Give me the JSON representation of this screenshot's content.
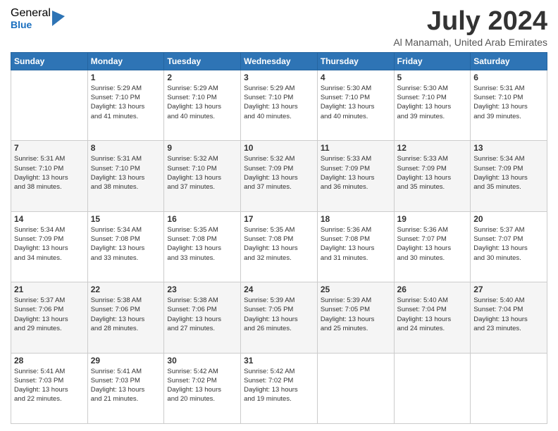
{
  "logo": {
    "general": "General",
    "blue": "Blue"
  },
  "header": {
    "month": "July 2024",
    "location": "Al Manamah, United Arab Emirates"
  },
  "weekdays": [
    "Sunday",
    "Monday",
    "Tuesday",
    "Wednesday",
    "Thursday",
    "Friday",
    "Saturday"
  ],
  "weeks": [
    [
      {
        "day": "",
        "info": ""
      },
      {
        "day": "1",
        "info": "Sunrise: 5:29 AM\nSunset: 7:10 PM\nDaylight: 13 hours\nand 41 minutes."
      },
      {
        "day": "2",
        "info": "Sunrise: 5:29 AM\nSunset: 7:10 PM\nDaylight: 13 hours\nand 40 minutes."
      },
      {
        "day": "3",
        "info": "Sunrise: 5:29 AM\nSunset: 7:10 PM\nDaylight: 13 hours\nand 40 minutes."
      },
      {
        "day": "4",
        "info": "Sunrise: 5:30 AM\nSunset: 7:10 PM\nDaylight: 13 hours\nand 40 minutes."
      },
      {
        "day": "5",
        "info": "Sunrise: 5:30 AM\nSunset: 7:10 PM\nDaylight: 13 hours\nand 39 minutes."
      },
      {
        "day": "6",
        "info": "Sunrise: 5:31 AM\nSunset: 7:10 PM\nDaylight: 13 hours\nand 39 minutes."
      }
    ],
    [
      {
        "day": "7",
        "info": "Sunrise: 5:31 AM\nSunset: 7:10 PM\nDaylight: 13 hours\nand 38 minutes."
      },
      {
        "day": "8",
        "info": "Sunrise: 5:31 AM\nSunset: 7:10 PM\nDaylight: 13 hours\nand 38 minutes."
      },
      {
        "day": "9",
        "info": "Sunrise: 5:32 AM\nSunset: 7:10 PM\nDaylight: 13 hours\nand 37 minutes."
      },
      {
        "day": "10",
        "info": "Sunrise: 5:32 AM\nSunset: 7:09 PM\nDaylight: 13 hours\nand 37 minutes."
      },
      {
        "day": "11",
        "info": "Sunrise: 5:33 AM\nSunset: 7:09 PM\nDaylight: 13 hours\nand 36 minutes."
      },
      {
        "day": "12",
        "info": "Sunrise: 5:33 AM\nSunset: 7:09 PM\nDaylight: 13 hours\nand 35 minutes."
      },
      {
        "day": "13",
        "info": "Sunrise: 5:34 AM\nSunset: 7:09 PM\nDaylight: 13 hours\nand 35 minutes."
      }
    ],
    [
      {
        "day": "14",
        "info": "Sunrise: 5:34 AM\nSunset: 7:09 PM\nDaylight: 13 hours\nand 34 minutes."
      },
      {
        "day": "15",
        "info": "Sunrise: 5:34 AM\nSunset: 7:08 PM\nDaylight: 13 hours\nand 33 minutes."
      },
      {
        "day": "16",
        "info": "Sunrise: 5:35 AM\nSunset: 7:08 PM\nDaylight: 13 hours\nand 33 minutes."
      },
      {
        "day": "17",
        "info": "Sunrise: 5:35 AM\nSunset: 7:08 PM\nDaylight: 13 hours\nand 32 minutes."
      },
      {
        "day": "18",
        "info": "Sunrise: 5:36 AM\nSunset: 7:08 PM\nDaylight: 13 hours\nand 31 minutes."
      },
      {
        "day": "19",
        "info": "Sunrise: 5:36 AM\nSunset: 7:07 PM\nDaylight: 13 hours\nand 30 minutes."
      },
      {
        "day": "20",
        "info": "Sunrise: 5:37 AM\nSunset: 7:07 PM\nDaylight: 13 hours\nand 30 minutes."
      }
    ],
    [
      {
        "day": "21",
        "info": "Sunrise: 5:37 AM\nSunset: 7:06 PM\nDaylight: 13 hours\nand 29 minutes."
      },
      {
        "day": "22",
        "info": "Sunrise: 5:38 AM\nSunset: 7:06 PM\nDaylight: 13 hours\nand 28 minutes."
      },
      {
        "day": "23",
        "info": "Sunrise: 5:38 AM\nSunset: 7:06 PM\nDaylight: 13 hours\nand 27 minutes."
      },
      {
        "day": "24",
        "info": "Sunrise: 5:39 AM\nSunset: 7:05 PM\nDaylight: 13 hours\nand 26 minutes."
      },
      {
        "day": "25",
        "info": "Sunrise: 5:39 AM\nSunset: 7:05 PM\nDaylight: 13 hours\nand 25 minutes."
      },
      {
        "day": "26",
        "info": "Sunrise: 5:40 AM\nSunset: 7:04 PM\nDaylight: 13 hours\nand 24 minutes."
      },
      {
        "day": "27",
        "info": "Sunrise: 5:40 AM\nSunset: 7:04 PM\nDaylight: 13 hours\nand 23 minutes."
      }
    ],
    [
      {
        "day": "28",
        "info": "Sunrise: 5:41 AM\nSunset: 7:03 PM\nDaylight: 13 hours\nand 22 minutes."
      },
      {
        "day": "29",
        "info": "Sunrise: 5:41 AM\nSunset: 7:03 PM\nDaylight: 13 hours\nand 21 minutes."
      },
      {
        "day": "30",
        "info": "Sunrise: 5:42 AM\nSunset: 7:02 PM\nDaylight: 13 hours\nand 20 minutes."
      },
      {
        "day": "31",
        "info": "Sunrise: 5:42 AM\nSunset: 7:02 PM\nDaylight: 13 hours\nand 19 minutes."
      },
      {
        "day": "",
        "info": ""
      },
      {
        "day": "",
        "info": ""
      },
      {
        "day": "",
        "info": ""
      }
    ]
  ]
}
